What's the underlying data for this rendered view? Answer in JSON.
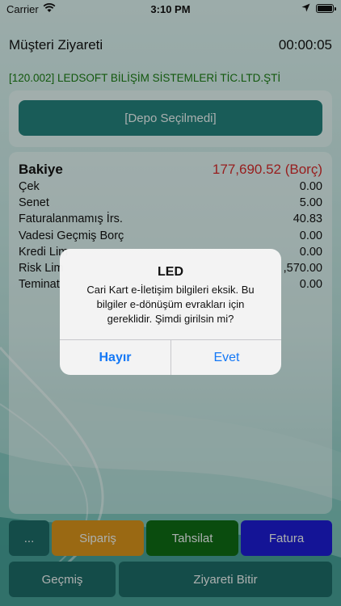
{
  "status_bar": {
    "carrier": "Carrier",
    "time": "3:10 PM"
  },
  "header": {
    "title": "Müşteri Ziyareti",
    "timer": "00:00:05"
  },
  "customer": "[120.002] LEDSOFT BİLİŞİM SİSTEMLERİ TİC.LTD.ŞTİ",
  "depo_button": "[Depo Seçilmedi]",
  "balance": {
    "title": "Bakiye",
    "total": "177,690.52 (Borç)",
    "rows": [
      {
        "label": "Çek",
        "value": "0.00"
      },
      {
        "label": "Senet",
        "value": "5.00"
      },
      {
        "label": "Faturalanmamış İrs.",
        "value": "40.83"
      },
      {
        "label": "Vadesi Geçmiş Borç",
        "value": "0.00"
      },
      {
        "label": "Kredi Lim",
        "value": "0.00"
      },
      {
        "label": "Risk Lim",
        "value": ",570.00"
      },
      {
        "label": "Teminat",
        "value": "0.00"
      }
    ]
  },
  "alert": {
    "title": "LED",
    "message": "Cari Kart e-İletişim bilgileri eksik. Bu bilgiler e-dönüşüm evrakları için gereklidir. Şimdi girilsin mi?",
    "cancel": "Hayır",
    "confirm": "Evet"
  },
  "actions": {
    "more": "...",
    "siparis": "Sipariş",
    "tahsilat": "Tahsilat",
    "fatura": "Fatura",
    "gecmis": "Geçmiş",
    "bitir": "Ziyareti Bitir"
  },
  "colors": {
    "teal_button": "#23807a",
    "order": "#d6921b",
    "collection": "#0f6a14",
    "invoice": "#1d1dd0",
    "debt_red": "#d22b2b",
    "customer_green": "#1a7a13",
    "ios_blue": "#1478f6"
  }
}
